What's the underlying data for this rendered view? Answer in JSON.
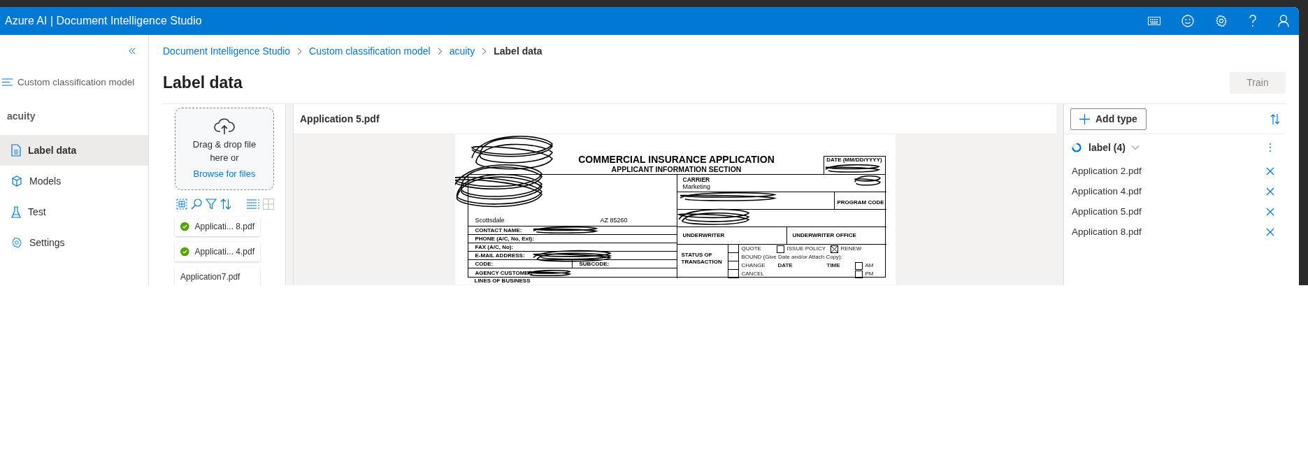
{
  "app_bar": {
    "title": "Azure AI | Document Intelligence Studio"
  },
  "sidebar": {
    "project_type": "Custom classification model",
    "project": "acuity",
    "items": [
      {
        "label": "Label data",
        "selected": true
      },
      {
        "label": "Models",
        "selected": false
      },
      {
        "label": "Test",
        "selected": false
      },
      {
        "label": "Settings",
        "selected": false
      }
    ]
  },
  "breadcrumb": [
    {
      "label": "Document Intelligence Studio",
      "current": false
    },
    {
      "label": "Custom classification model",
      "current": false
    },
    {
      "label": "acuity",
      "current": false
    },
    {
      "label": "Label data",
      "current": true
    }
  ],
  "page_title": "Label data",
  "train_button": {
    "label": "Train",
    "disabled": true
  },
  "upload": {
    "text": "Drag & drop file here or",
    "link": "Browse for files"
  },
  "view_toggle": [
    {
      "kind": "list",
      "selected": true
    },
    {
      "kind": "grid",
      "selected": false
    }
  ],
  "files": [
    {
      "name": "Applicati... 8.pdf",
      "labeled": true
    },
    {
      "name": "Applicati... 4.pdf",
      "labeled": true
    },
    {
      "name": "Application7.pdf",
      "labeled": false
    }
  ],
  "document": {
    "file_name": "Application 5.pdf",
    "form": {
      "title": "COMMERCIAL INSURANCE APPLICATION",
      "subtitle": "APPLICANT INFORMATION SECTION",
      "date_label": "DATE (MM/DD/YYYY)",
      "city": "Scottsdale",
      "state_zip": "AZ  85260",
      "contact_rows": [
        "CONTACT NAME:",
        "PHONE (A/C, No, Ext):",
        "FAX (A/C, No):",
        "E-MAIL ADDRESS:"
      ],
      "code_label": "CODE:",
      "subcode_label": "SUBCODE:",
      "customer_label": "AGENCY CUSTOMER",
      "carrier_label": "CARRIER",
      "carrier_value": "Marketing",
      "program_code_label": "PROGRAM CODE",
      "underwriter_label": "UNDERWRITER",
      "underwriter_office_label": "UNDERWRITER OFFICE",
      "status_label": "STATUS OF TRANSACTION",
      "status_options": [
        {
          "label": "QUOTE",
          "checked": false
        },
        {
          "label": "ISSUE POLICY",
          "checked": false
        },
        {
          "label": "RENEW",
          "checked": true
        },
        {
          "label": "BOUND (Give Date and/or Attach Copy):",
          "checked": false
        },
        {
          "label": "CHANGE",
          "checked": false
        },
        {
          "label": "CANCEL",
          "checked": false
        }
      ],
      "date_col": "DATE",
      "time_col": "TIME",
      "time_options": [
        {
          "label": "AM",
          "checked": false
        },
        {
          "label": "PM",
          "checked": false
        }
      ],
      "lines_label": "LINES OF BUSINESS"
    }
  },
  "types_panel": {
    "add_button": "Add type",
    "groups": [
      {
        "name": "label (4)",
        "expanded": true,
        "files": [
          "Application 2.pdf",
          "Application 4.pdf",
          "Application 5.pdf",
          "Application 8.pdf"
        ]
      }
    ]
  }
}
